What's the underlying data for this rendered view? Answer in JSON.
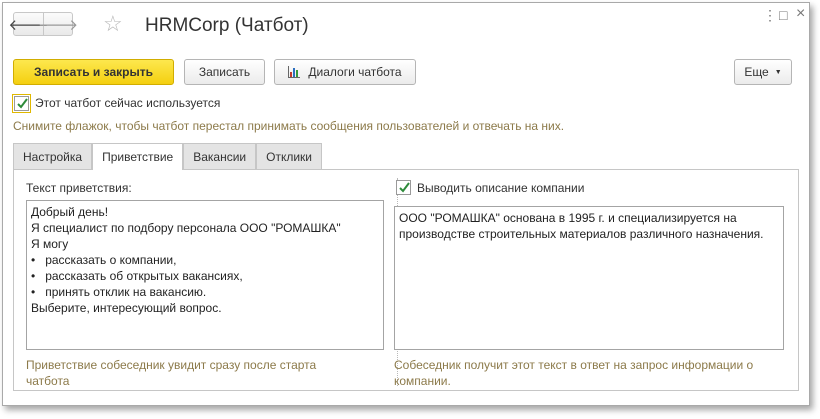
{
  "window": {
    "title": "HRMCorp (Чатбот)"
  },
  "nav": {
    "back_icon": "arrow-left-icon",
    "forward_icon": "arrow-right-icon",
    "back_glyph": "🡐",
    "forward_glyph": "🡒",
    "star_glyph": "☆"
  },
  "window_controls": {
    "menu_glyph": "⋮",
    "maximize_glyph": "□",
    "close_glyph": "×"
  },
  "toolbar": {
    "save_close_label": "Записать и закрыть",
    "save_label": "Записать",
    "dialogs_label": "Диалоги чатбота",
    "more_label": "Еще",
    "more_caret": "▼"
  },
  "active_checkbox": {
    "label": "Этот чатбот сейчас используется",
    "checked": true,
    "hint": "Снимите флажок, чтобы чатбот перестал принимать сообщения пользователей и отвечать на них."
  },
  "tabs": [
    {
      "label": "Настройка",
      "active": false
    },
    {
      "label": "Приветствие",
      "active": true
    },
    {
      "label": "Вакансии",
      "active": false
    },
    {
      "label": "Отклики",
      "active": false
    }
  ],
  "greeting": {
    "field_label": "Текст приветствия:",
    "text": "Добрый день!\nЯ специалист по подбору персонала ООО \"РОМАШКА\"\nЯ могу\n•   рассказать о компании,\n•   рассказать об открытых вакансиях,\n•   принять отклик на вакансию.\nВыберите, интересующий вопрос.",
    "hint": "Приветствие собеседник увидит сразу после старта чатбота"
  },
  "company": {
    "checkbox_label": "Выводить описание компании",
    "checked": true,
    "text": "ООО \"РОМАШКА\" основана в 1995 г. и специализируется на производстве строительных материалов различного назначения.",
    "hint": "Собеседник получит этот текст в ответ на запрос информации о компании."
  },
  "colors": {
    "primary_button": "#f4cf10",
    "checkmark": "#2e8b3a",
    "hint": "#8c7a4a"
  }
}
